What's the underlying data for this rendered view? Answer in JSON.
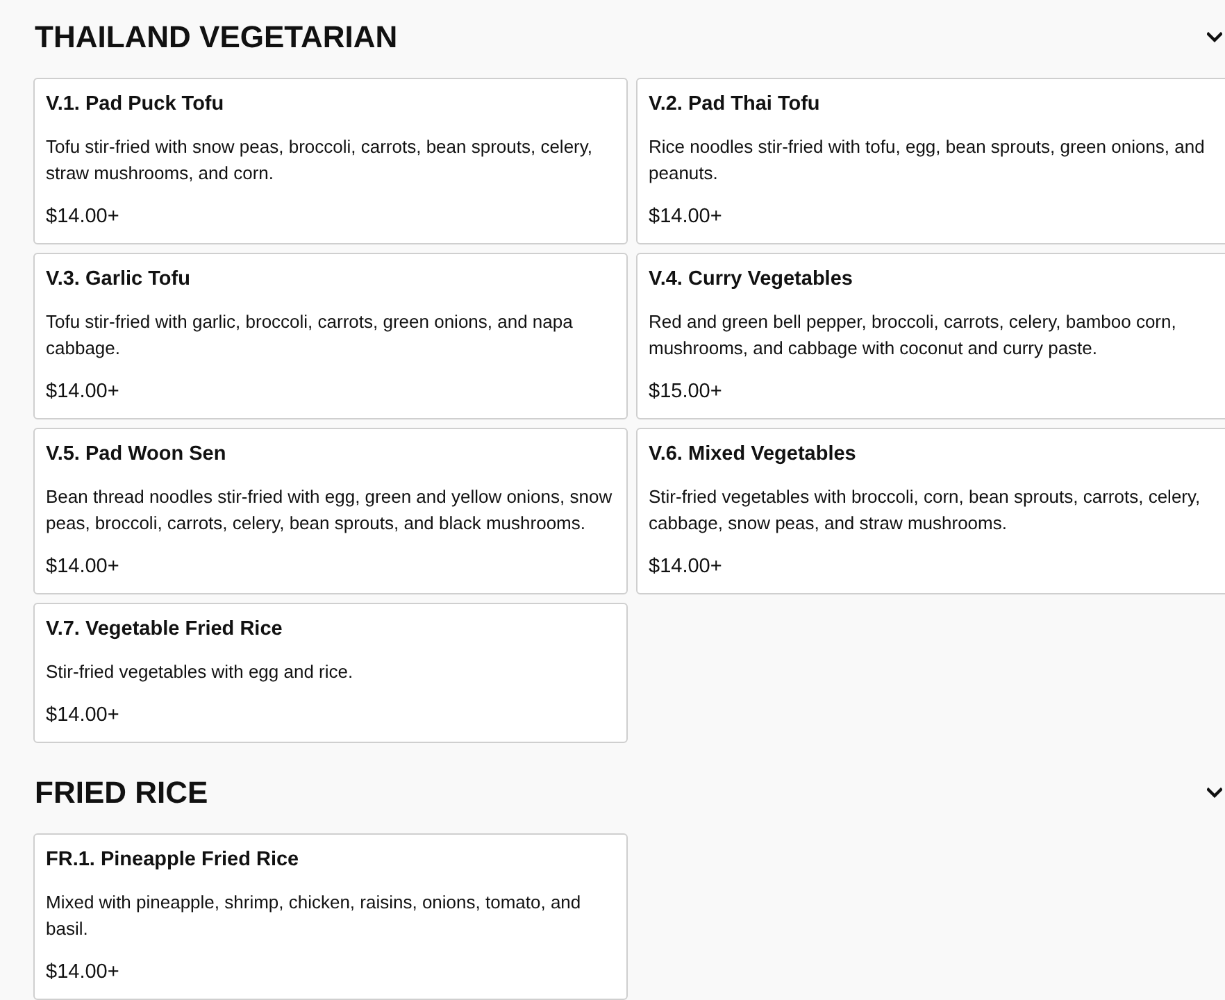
{
  "sections": [
    {
      "title": "THAILAND VEGETARIAN",
      "expanded": true,
      "items": [
        {
          "name": "V.1. Pad Puck Tofu",
          "description": "Tofu stir-fried with snow peas, broccoli, carrots, bean sprouts, celery, straw mushrooms, and corn.",
          "price": "$14.00+"
        },
        {
          "name": "V.2. Pad Thai Tofu",
          "description": "Rice noodles stir-fried with tofu, egg, bean sprouts, green onions, and peanuts.",
          "price": "$14.00+"
        },
        {
          "name": "V.3. Garlic Tofu",
          "description": "Tofu stir-fried with garlic, broccoli, carrots, green onions, and napa cabbage.",
          "price": "$14.00+"
        },
        {
          "name": "V.4. Curry Vegetables",
          "description": "Red and green bell pepper, broccoli, carrots, celery, bamboo corn, mushrooms, and cabbage with coconut and curry paste.",
          "price": "$15.00+"
        },
        {
          "name": "V.5. Pad Woon Sen",
          "description": "Bean thread noodles stir-fried with egg, green and yellow onions, snow peas, broccoli, carrots, celery, bean sprouts, and black mushrooms.",
          "price": "$14.00+"
        },
        {
          "name": "V.6. Mixed Vegetables",
          "description": "Stir-fried vegetables with broccoli, corn, bean sprouts, carrots, celery, cabbage, snow peas, and straw mushrooms.",
          "price": "$14.00+"
        },
        {
          "name": "V.7. Vegetable Fried Rice",
          "description": "Stir-fried vegetables with egg and rice.",
          "price": "$14.00+"
        }
      ]
    },
    {
      "title": "FRIED RICE",
      "expanded": true,
      "items": [
        {
          "name": "FR.1. Pineapple Fried Rice",
          "description": "Mixed with pineapple, shrimp, chicken, raisins, onions, tomato, and basil.",
          "price": "$14.00+"
        }
      ]
    }
  ]
}
